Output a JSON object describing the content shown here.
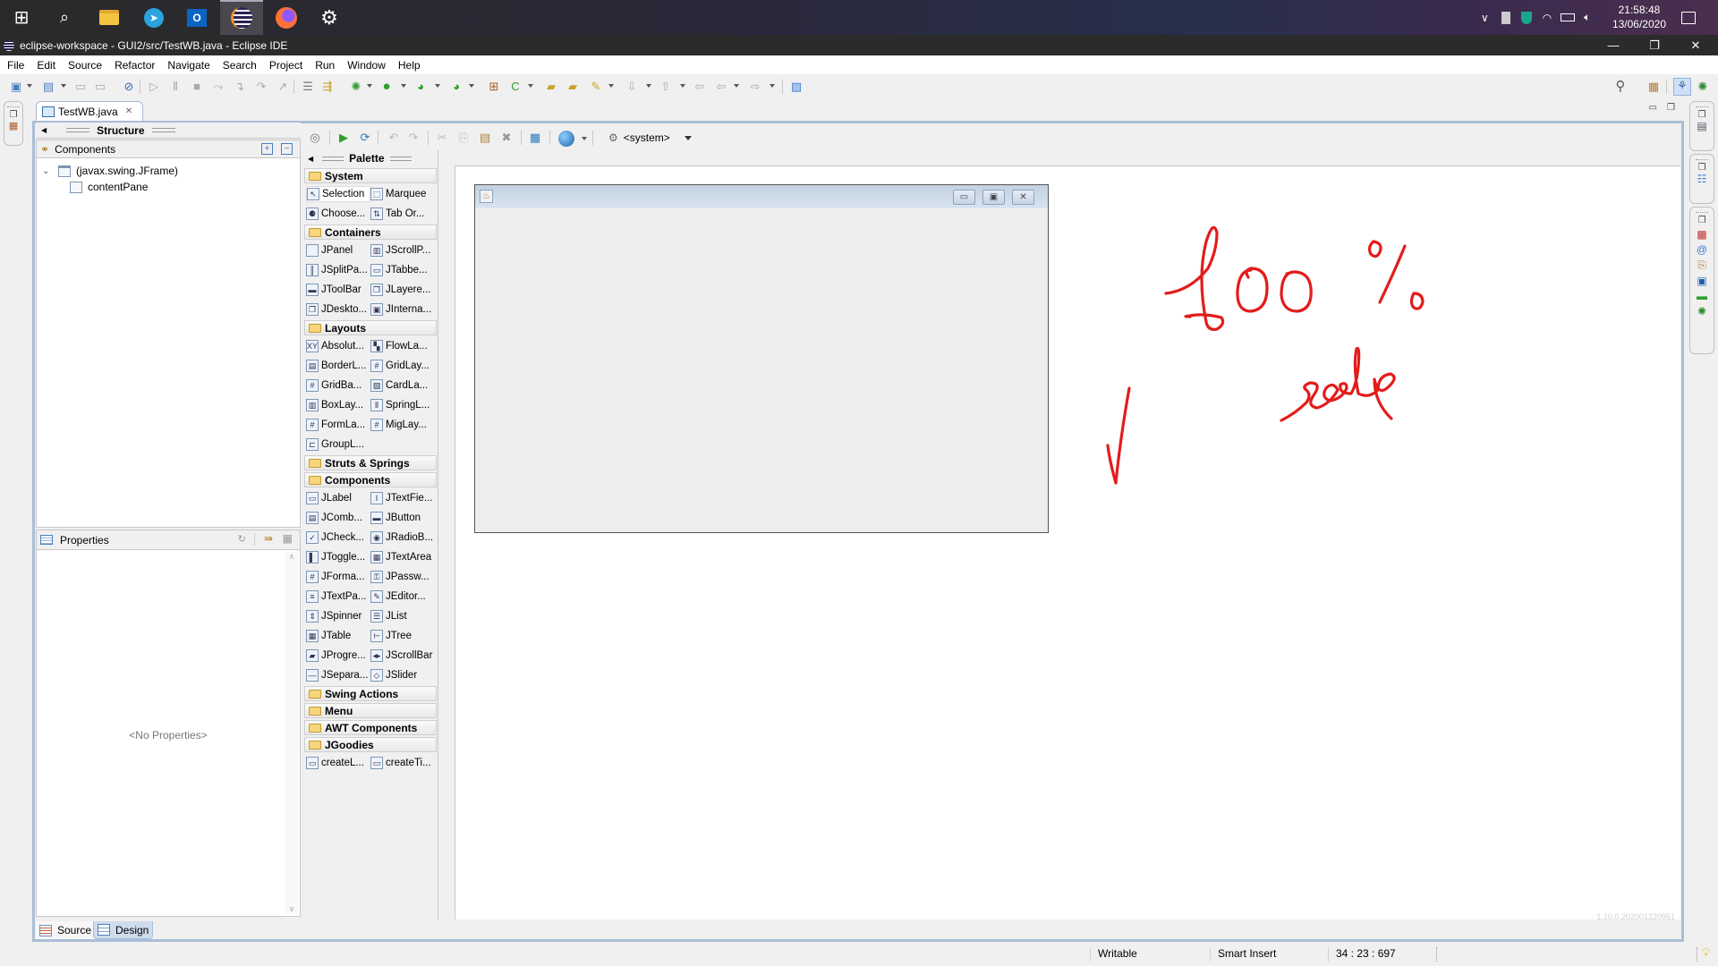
{
  "taskbar": {
    "apps": [
      {
        "name": "start",
        "glyph": "⊞"
      },
      {
        "name": "search",
        "glyph": "⚲"
      },
      {
        "name": "file-explorer",
        "glyph": "▬"
      },
      {
        "name": "telegram",
        "glyph": "➤"
      },
      {
        "name": "outlook",
        "glyph": "O"
      },
      {
        "name": "eclipse",
        "glyph": "◐"
      },
      {
        "name": "firefox",
        "glyph": "●"
      },
      {
        "name": "settings",
        "glyph": "⚙"
      }
    ],
    "clock_time": "21:58:48",
    "clock_date": "13/06/2020"
  },
  "window": {
    "title": "eclipse-workspace - GUI2/src/TestWB.java - Eclipse IDE"
  },
  "menu": [
    "File",
    "Edit",
    "Source",
    "Refactor",
    "Navigate",
    "Search",
    "Project",
    "Run",
    "Window",
    "Help"
  ],
  "editor": {
    "tab_label": "TestWB.java"
  },
  "structure": {
    "title": "Structure",
    "components_label": "Components",
    "tree": [
      {
        "label": "(javax.swing.JFrame)",
        "level": 0,
        "expanded": true
      },
      {
        "label": "contentPane",
        "level": 1
      }
    ]
  },
  "properties": {
    "title": "Properties",
    "empty_text": "<No Properties>"
  },
  "design_toolbar": {
    "system_label": "<system>"
  },
  "palette": {
    "title": "Palette",
    "categories": [
      {
        "label": "System",
        "open": true,
        "items": [
          [
            "Selection",
            "Marquee"
          ],
          [
            "Choose...",
            "Tab Or..."
          ]
        ]
      },
      {
        "label": "Containers",
        "open": true,
        "items": [
          [
            "JPanel",
            "JScrollP..."
          ],
          [
            "JSplitPa...",
            "JTabbe..."
          ],
          [
            "JToolBar",
            "JLayere..."
          ],
          [
            "JDeskto...",
            "JInterna..."
          ]
        ]
      },
      {
        "label": "Layouts",
        "open": true,
        "items": [
          [
            "Absolut...",
            "FlowLa..."
          ],
          [
            "BorderL...",
            "GridLay..."
          ],
          [
            "GridBa...",
            "CardLa..."
          ],
          [
            "BoxLay...",
            "SpringL..."
          ],
          [
            "FormLa...",
            "MigLay..."
          ],
          [
            "GroupL...",
            ""
          ]
        ]
      },
      {
        "label": "Struts & Springs",
        "open": false,
        "items": []
      },
      {
        "label": "Components",
        "open": true,
        "items": [
          [
            "JLabel",
            "JTextFie..."
          ],
          [
            "JComb...",
            "JButton"
          ],
          [
            "JCheck...",
            "JRadioB..."
          ],
          [
            "JToggle...",
            "JTextArea"
          ],
          [
            "JForma...",
            "JPassw..."
          ],
          [
            "JTextPa...",
            "JEditor..."
          ],
          [
            "JSpinner",
            "JList"
          ],
          [
            "JTable",
            "JTree"
          ],
          [
            "JProgre...",
            "JScrollBar"
          ],
          [
            "JSepara...",
            "JSlider"
          ]
        ]
      },
      {
        "label": "Swing Actions",
        "open": false,
        "items": []
      },
      {
        "label": "Menu",
        "open": false,
        "items": []
      },
      {
        "label": "AWT Components",
        "open": false,
        "items": []
      },
      {
        "label": "JGoodies",
        "open": true,
        "items": [
          [
            "createL...",
            "createTi..."
          ]
        ]
      }
    ]
  },
  "annotation": {
    "text": "100 % scale",
    "color": "#e31c1c"
  },
  "canvas": {
    "version_text": "1.10.0.202001220951"
  },
  "bottom_tabs": {
    "source": "Source",
    "design": "Design"
  },
  "status": {
    "mode": "Writable",
    "insert": "Smart Insert",
    "position": "34 : 23 : 697"
  }
}
